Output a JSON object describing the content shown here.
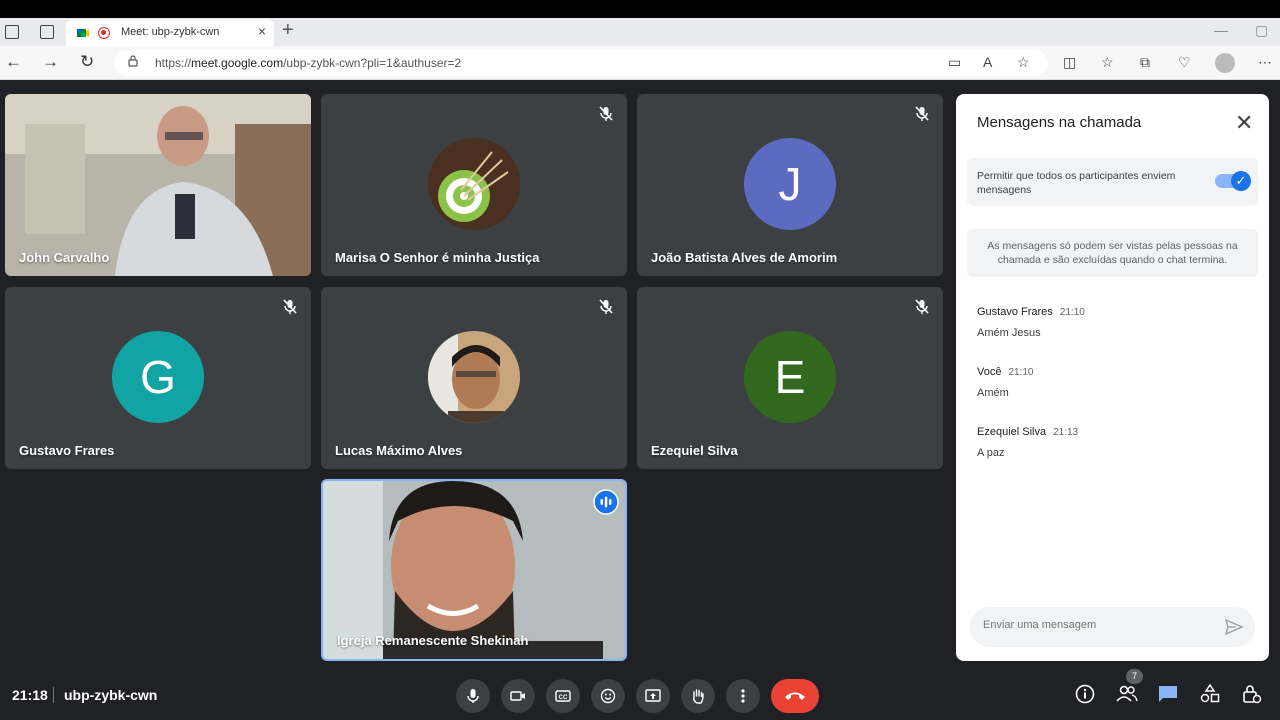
{
  "browser": {
    "tab_title": "Meet: ubp-zybk-cwn",
    "url_prefix": "https://",
    "url_host": "meet.google.com",
    "url_path": "/ubp-zybk-cwn?pli=1&authuser=2"
  },
  "participants": [
    {
      "name": "John Carvalho",
      "type": "video"
    },
    {
      "name": "Marisa O Senhor é minha Justiça",
      "type": "avatar-image",
      "muted": true
    },
    {
      "name": "João Batista Alves de Amorim",
      "type": "initial",
      "initial": "J",
      "color": "#5c6bc0",
      "muted": true
    },
    {
      "name": "Gustavo Frares",
      "type": "initial",
      "initial": "G",
      "color": "#12a4a4",
      "muted": true
    },
    {
      "name": "Lucas Máximo Alves",
      "type": "avatar-image",
      "muted": true
    },
    {
      "name": "Ezequiel Silva",
      "type": "initial",
      "initial": "E",
      "color": "#33691e",
      "muted": true
    },
    {
      "name": "Igreja Remanescente Shekinah",
      "type": "video",
      "speaking": true
    }
  ],
  "chat": {
    "title": "Mensagens na chamada",
    "allow_text": "Permitir que todos os participantes enviem mensagens",
    "info_text": "As mensagens só podem ser vistas pelas pessoas na chamada e são excluídas quando o chat termina.",
    "messages": [
      {
        "sender": "Gustavo Frares",
        "time": "21:10",
        "text": "Amém Jesus"
      },
      {
        "sender": "Você",
        "time": "21:10",
        "text": "Amém"
      },
      {
        "sender": "Ezequiel Silva",
        "time": "21:13",
        "text": "A paz"
      }
    ],
    "input_placeholder": "Enviar uma mensagem"
  },
  "bottom": {
    "time": "21:18",
    "meeting_code": "ubp-zybk-cwn",
    "people_count": "7"
  },
  "colors": {
    "background": "#202124",
    "tile": "#3c4043",
    "end_call": "#ea4335",
    "accent": "#1a73e8",
    "chat_icon": "#8ab4f8"
  }
}
